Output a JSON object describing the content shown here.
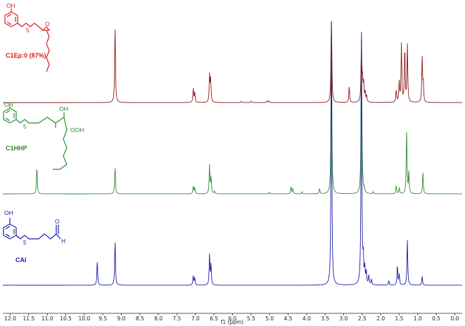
{
  "chart_data": {
    "type": "line",
    "xlabel": "f1 (ppm)",
    "xlim": [
      12.2,
      -0.2
    ],
    "x_ticks": [
      "12.0",
      "11.5",
      "11.0",
      "10.5",
      "10.0",
      "9.5",
      "9.0",
      "8.5",
      "8.0",
      "7.5",
      "7.0",
      "6.5",
      "6.0",
      "5.5",
      "5.0",
      "4.5",
      "4.0",
      "3.5",
      "3.0",
      "2.5",
      "2.0",
      "1.5",
      "1.0",
      "0.5",
      "0.0"
    ],
    "series": [
      {
        "name": "C1Ep:0 (87%)",
        "color": "#8b1a1a",
        "peaks": [
          {
            "ppm": 9.17,
            "h": 0.97
          },
          {
            "ppm": 7.06,
            "h": 0.17
          },
          {
            "ppm": 7.02,
            "h": 0.12
          },
          {
            "ppm": 6.62,
            "h": 0.33
          },
          {
            "ppm": 6.59,
            "h": 0.28
          },
          {
            "ppm": 5.76,
            "h": 0.015
          },
          {
            "ppm": 5.5,
            "h": 0.02
          },
          {
            "ppm": 5.07,
            "h": 0.02
          },
          {
            "ppm": 5.02,
            "h": 0.02
          },
          {
            "ppm": 3.33,
            "h": 1.2
          },
          {
            "ppm": 2.85,
            "h": 0.2
          },
          {
            "ppm": 2.52,
            "h": 0.75
          },
          {
            "ppm": 2.49,
            "h": 0.25
          },
          {
            "ppm": 2.46,
            "h": 0.22
          },
          {
            "ppm": 2.42,
            "h": 0.12
          },
          {
            "ppm": 2.38,
            "h": 0.08
          },
          {
            "ppm": 1.58,
            "h": 0.15
          },
          {
            "ppm": 1.5,
            "h": 0.25
          },
          {
            "ppm": 1.44,
            "h": 0.72
          },
          {
            "ppm": 1.35,
            "h": 0.67
          },
          {
            "ppm": 1.28,
            "h": 0.72
          },
          {
            "ppm": 0.88,
            "h": 0.56
          },
          {
            "ppm": 0.85,
            "h": 0.22
          }
        ]
      },
      {
        "name": "C1HHP",
        "color": "#2e8b2e",
        "peaks": [
          {
            "ppm": 11.28,
            "h": 0.26
          },
          {
            "ppm": 9.17,
            "h": 0.26
          },
          {
            "ppm": 7.06,
            "h": 0.07
          },
          {
            "ppm": 7.02,
            "h": 0.06
          },
          {
            "ppm": 6.62,
            "h": 0.27
          },
          {
            "ppm": 6.58,
            "h": 0.15
          },
          {
            "ppm": 6.49,
            "h": 0.025
          },
          {
            "ppm": 5.0,
            "h": 0.015
          },
          {
            "ppm": 4.42,
            "h": 0.07
          },
          {
            "ppm": 4.37,
            "h": 0.05
          },
          {
            "ppm": 4.12,
            "h": 0.02
          },
          {
            "ppm": 3.65,
            "h": 0.05
          },
          {
            "ppm": 3.33,
            "h": 1.6
          },
          {
            "ppm": 2.52,
            "h": 1.5
          },
          {
            "ppm": 2.48,
            "h": 0.06
          },
          {
            "ppm": 2.44,
            "h": 0.04
          },
          {
            "ppm": 2.2,
            "h": 0.02
          },
          {
            "ppm": 1.58,
            "h": 0.08
          },
          {
            "ppm": 1.5,
            "h": 0.06
          },
          {
            "ppm": 1.3,
            "h": 0.6
          },
          {
            "ppm": 1.24,
            "h": 0.2
          },
          {
            "ppm": 0.86,
            "h": 0.2
          }
        ]
      },
      {
        "name": "CAI",
        "color": "#1c1caa",
        "peaks": [
          {
            "ppm": 11.95,
            "h": 0.003
          },
          {
            "ppm": 9.65,
            "h": 0.27
          },
          {
            "ppm": 9.17,
            "h": 0.5
          },
          {
            "ppm": 7.06,
            "h": 0.1
          },
          {
            "ppm": 7.02,
            "h": 0.08
          },
          {
            "ppm": 6.62,
            "h": 0.33
          },
          {
            "ppm": 6.58,
            "h": 0.22
          },
          {
            "ppm": 3.33,
            "h": 2.9
          },
          {
            "ppm": 2.52,
            "h": 2.8
          },
          {
            "ppm": 2.47,
            "h": 0.25
          },
          {
            "ppm": 2.43,
            "h": 0.17
          },
          {
            "ppm": 2.39,
            "h": 0.14
          },
          {
            "ppm": 2.32,
            "h": 0.1
          },
          {
            "ppm": 2.25,
            "h": 0.06
          },
          {
            "ppm": 1.78,
            "h": 0.05
          },
          {
            "ppm": 1.55,
            "h": 0.22
          },
          {
            "ppm": 1.5,
            "h": 0.12
          },
          {
            "ppm": 1.28,
            "h": 0.5
          },
          {
            "ppm": 0.88,
            "h": 0.1
          }
        ]
      }
    ]
  },
  "structures": {
    "top": {
      "label": "C1Ep:0 (87%)",
      "oh": "OH",
      "sub": "5"
    },
    "middle": {
      "label": "C1HHP",
      "oh": "OH",
      "sub": "5",
      "oh2": "OH",
      "ooh": "OOH"
    },
    "bottom": {
      "label": "CAI",
      "oh": "OH",
      "sub": "5",
      "o": "O",
      "h": "H"
    }
  }
}
